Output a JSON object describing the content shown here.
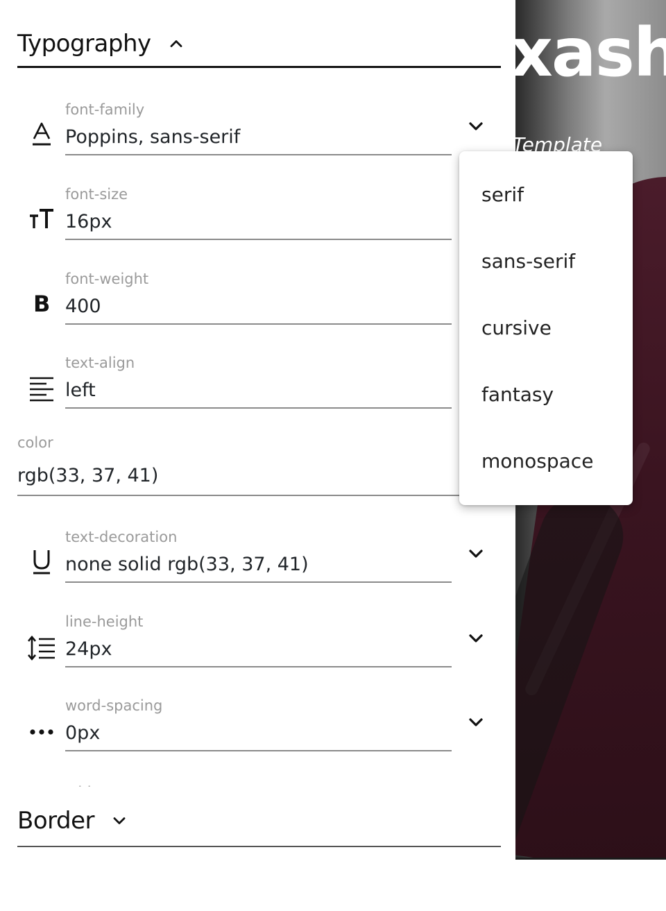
{
  "panel": {
    "typography_title": "Typography",
    "border_title": "Border",
    "fields": [
      {
        "label": "font-family",
        "value": "Poppins, sans-serif",
        "icon": "font-family-icon",
        "has_dropdown": true
      },
      {
        "label": "font-size",
        "value": "16px",
        "icon": "font-size-icon",
        "has_dropdown": false
      },
      {
        "label": "font-weight",
        "value": "400",
        "icon": "bold-icon",
        "has_dropdown": false
      },
      {
        "label": "text-align",
        "value": "left",
        "icon": "align-left-icon",
        "has_dropdown": false
      },
      {
        "label": "text-decoration",
        "value": "none solid rgb(33, 37, 41)",
        "icon": "underline-icon",
        "has_dropdown": true
      },
      {
        "label": "line-height",
        "value": "24px",
        "icon": "line-height-icon",
        "has_dropdown": true
      },
      {
        "label": "word-spacing",
        "value": "0px",
        "icon": "more-horizontal-icon",
        "has_dropdown": true
      }
    ],
    "color": {
      "label": "color",
      "value": "rgb(33, 37, 41)"
    }
  },
  "dropdown": {
    "options": [
      "serif",
      "sans-serif",
      "cursive",
      "fantasy",
      "monospace"
    ]
  },
  "preview": {
    "hero_title": "xash",
    "hero_subtitle": "Template"
  },
  "colors": {
    "text": "#212529",
    "label": "#9a9a9a",
    "underline": "#8a8a8a",
    "dress": "#3b1522"
  }
}
